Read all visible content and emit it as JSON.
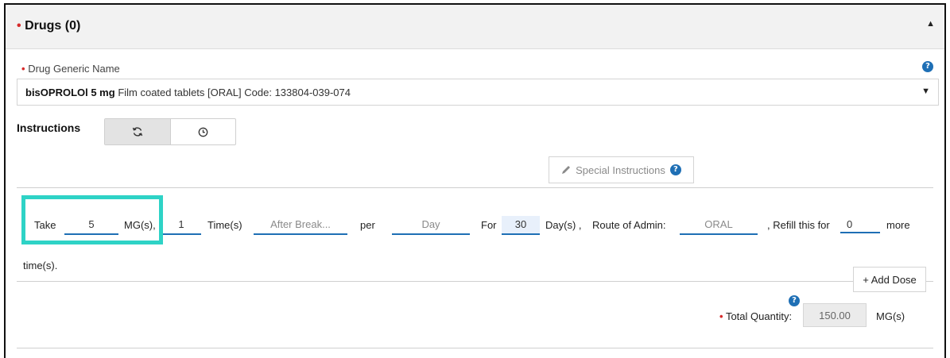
{
  "panel": {
    "title": "Drugs (0)"
  },
  "drug": {
    "label": "Drug Generic Name",
    "selected_bold": "bisOPROLOl 5 mg",
    "selected_rest": "Film coated tablets [ORAL] Code: 133804-039-074"
  },
  "instructions": {
    "label": "Instructions"
  },
  "special_instructions": {
    "label": "Special Instructions"
  },
  "dose": {
    "take_label": "Take",
    "take_value": "5",
    "unit_label": "MG(s),",
    "times_value": "1",
    "times_label": "Time(s)",
    "timing_placeholder": "After Break...",
    "per_label": "per",
    "period_value": "Day",
    "for_label": "For",
    "duration_value": "30",
    "duration_label": "Day(s) ,",
    "route_label": "Route of Admin:",
    "route_value": "ORAL",
    "refill_label": ", Refill this for",
    "refill_value": "0",
    "more_label": "more",
    "times_suffix": "time(s)."
  },
  "add_dose": {
    "label": "+ Add Dose"
  },
  "total_quantity": {
    "label": "Total Quantity:",
    "value": "150.00",
    "unit": "MG(s)"
  },
  "icons": {
    "collapse": "chevron-up-icon",
    "help": "question-circle-icon",
    "dropdown": "caret-down-icon",
    "repeat": "refresh-icon",
    "clock": "clock-icon",
    "pencil": "pencil-icon"
  },
  "colors": {
    "accent": "#1e6fb5",
    "required": "#d62b2b",
    "highlight": "#2ed3c6"
  }
}
